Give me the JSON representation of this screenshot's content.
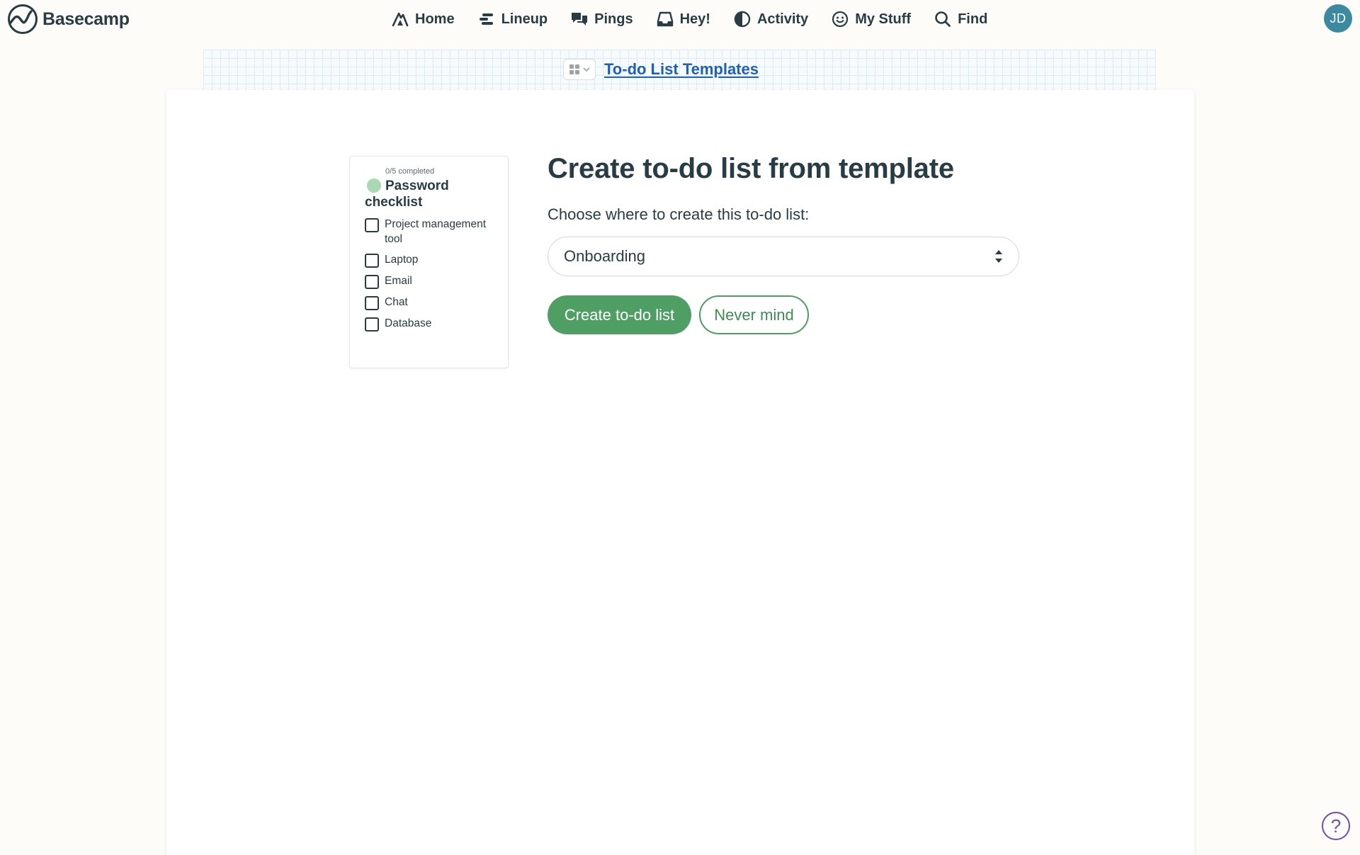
{
  "brand": {
    "name": "Basecamp",
    "icon": "basecamp-logo-icon"
  },
  "nav": {
    "items": [
      {
        "label": "Home",
        "icon": "home-icon"
      },
      {
        "label": "Lineup",
        "icon": "lineup-icon"
      },
      {
        "label": "Pings",
        "icon": "pings-icon"
      },
      {
        "label": "Hey!",
        "icon": "hey-inbox-icon"
      },
      {
        "label": "Activity",
        "icon": "activity-icon"
      },
      {
        "label": "My Stuff",
        "icon": "my-stuff-smiley-icon"
      },
      {
        "label": "Find",
        "icon": "search-icon"
      }
    ]
  },
  "user": {
    "initials": "JD",
    "avatar_color": "#3c8aa0"
  },
  "breadcrumb": {
    "switcher_icon": "grid-switcher-icon",
    "link": "To-do List Templates"
  },
  "preview": {
    "progress": "0/5 completed",
    "title": "Password checklist",
    "items": [
      "Project management tool",
      "Laptop",
      "Email",
      "Chat",
      "Database"
    ]
  },
  "form": {
    "title": "Create to-do list from template",
    "label": "Choose where to create this to-do list:",
    "selected_project": "Onboarding",
    "submit_label": "Create to-do list",
    "cancel_label": "Never mind"
  },
  "help": {
    "icon": "help-question-icon",
    "label": "?"
  },
  "colors": {
    "accent_green": "#4f9f64",
    "link_blue": "#1f5fb4",
    "text": "#283c46",
    "background": "#fdfcf8"
  }
}
